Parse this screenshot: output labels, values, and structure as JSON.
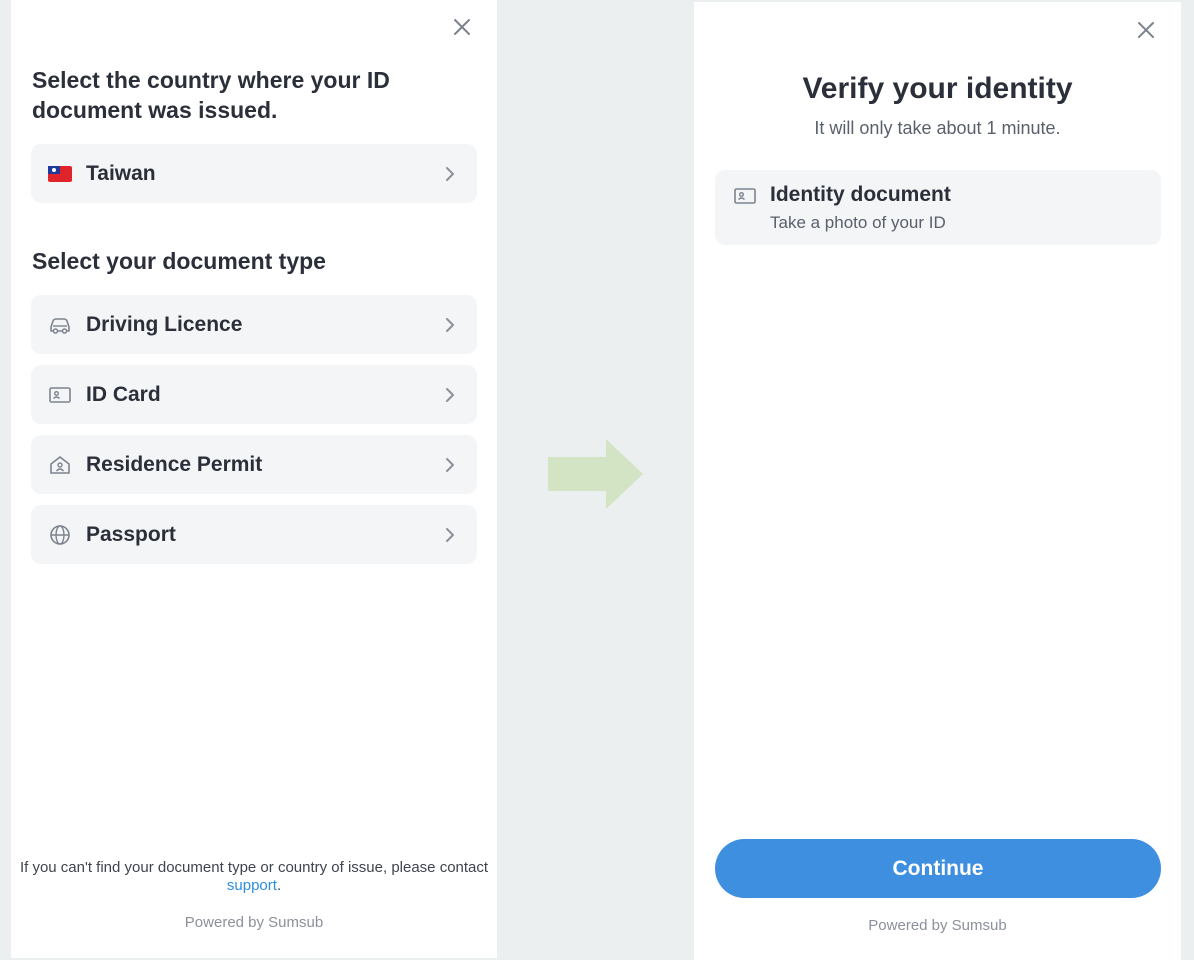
{
  "left_panel": {
    "country_title": "Select the country where your ID document was issued.",
    "country": {
      "label": "Taiwan",
      "icon": "taiwan-flag-icon"
    },
    "doctype_title": "Select your document type",
    "doc_types": [
      {
        "label": "Driving Licence",
        "icon": "car-icon"
      },
      {
        "label": "ID Card",
        "icon": "id-card-icon"
      },
      {
        "label": "Residence Permit",
        "icon": "house-person-icon"
      },
      {
        "label": "Passport",
        "icon": "globe-icon"
      }
    ],
    "footer_text": "If you can't find your document type or country of issue, please contact",
    "footer_link": "support",
    "footer_period": ".",
    "powered_by": "Powered by Sumsub"
  },
  "right_panel": {
    "title": "Verify your identity",
    "subtitle": "It will only take about 1 minute.",
    "step": {
      "title": "Identity document",
      "subtitle": "Take a photo of your ID",
      "icon": "id-card-icon"
    },
    "continue_label": "Continue",
    "powered_by": "Powered by Sumsub"
  },
  "colors": {
    "accent": "#3e8fe0",
    "link": "#2d8ee0",
    "arrow": "#d3e4c5",
    "card_bg": "#f4f5f7",
    "backdrop": "#eceff0"
  }
}
